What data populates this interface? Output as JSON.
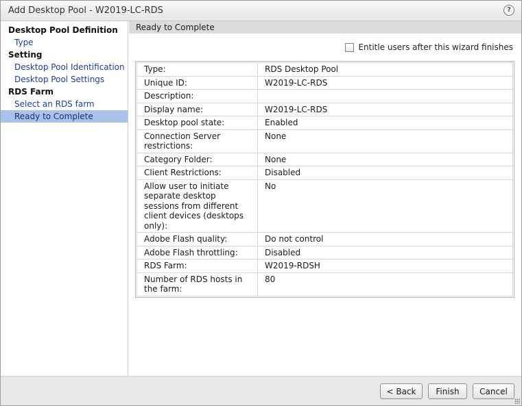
{
  "window": {
    "title": "Add Desktop Pool - W2019-LC-RDS",
    "help_glyph": "?"
  },
  "sidebar": {
    "sections": [
      {
        "heading": "Desktop Pool Definition",
        "items": [
          {
            "label": "Type"
          }
        ]
      },
      {
        "heading": "Setting",
        "items": [
          {
            "label": "Desktop Pool Identification"
          },
          {
            "label": "Desktop Pool Settings"
          }
        ]
      },
      {
        "heading": "RDS Farm",
        "items": [
          {
            "label": "Select an RDS farm"
          },
          {
            "label": "Ready to Complete",
            "active": true
          }
        ]
      }
    ]
  },
  "main": {
    "header": "Ready to Complete",
    "entitle": {
      "label": "Entitle users after this wizard finishes",
      "checked": false
    },
    "summary": [
      {
        "key": "Type:",
        "value": "RDS Desktop Pool"
      },
      {
        "key": "Unique ID:",
        "value": "W2019-LC-RDS"
      },
      {
        "key": "Description:",
        "value": ""
      },
      {
        "key": "Display name:",
        "value": "W2019-LC-RDS"
      },
      {
        "key": "Desktop pool state:",
        "value": "Enabled"
      },
      {
        "key": "Connection Server restrictions:",
        "value": "None"
      },
      {
        "key": "Category Folder:",
        "value": "None"
      },
      {
        "key": "Client Restrictions:",
        "value": "Disabled"
      },
      {
        "key": "Allow user to initiate separate desktop sessions from different client devices (desktops only):",
        "value": "No"
      },
      {
        "key": "Adobe Flash quality:",
        "value": "Do not control"
      },
      {
        "key": "Adobe Flash throttling:",
        "value": "Disabled"
      },
      {
        "key": "RDS Farm:",
        "value": "W2019-RDSH"
      },
      {
        "key": "Number of RDS hosts in the farm:",
        "value": "80"
      }
    ]
  },
  "footer": {
    "back_label": "< Back",
    "finish_label": "Finish",
    "cancel_label": "Cancel"
  },
  "colors": {
    "link": "#1c3ea8",
    "active_nav_bg": "#a9c2ea",
    "header_bg": "#dcdcdc",
    "footer_bg": "#e8e8e8"
  }
}
